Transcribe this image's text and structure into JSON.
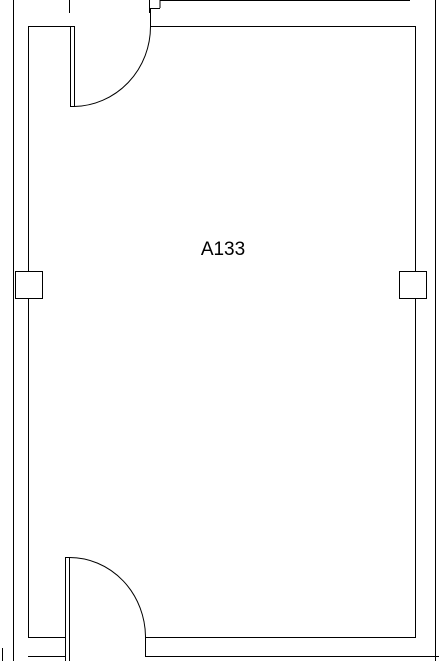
{
  "room": {
    "label": "A133"
  },
  "colors": {
    "line": "#000000",
    "background": "#ffffff"
  }
}
